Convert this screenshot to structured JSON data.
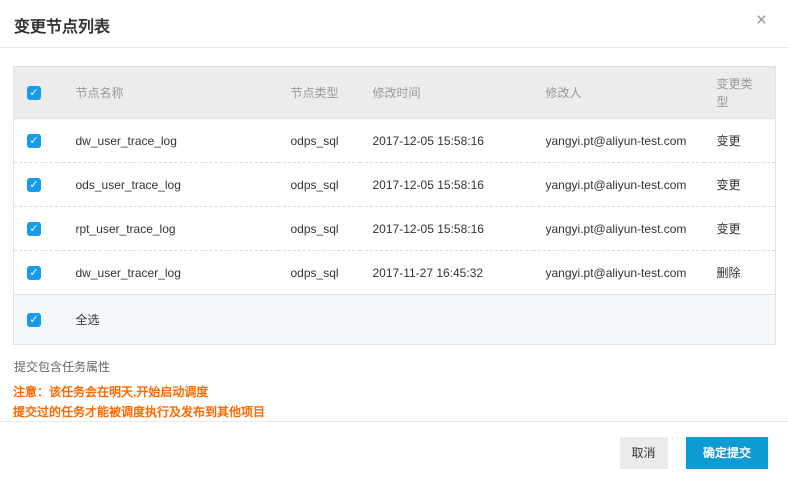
{
  "dialog": {
    "title": "变更节点列表"
  },
  "icons": {
    "check": "✓",
    "close": "×"
  },
  "table": {
    "headers": {
      "name": "节点名称",
      "type": "节点类型",
      "time": "修改时间",
      "person": "修改人",
      "change": "变更类型"
    },
    "rows": [
      {
        "name": "dw_user_trace_log",
        "type": "odps_sql",
        "time": "2017-12-05 15:58:16",
        "modifier": "yangyi.pt@aliyun-test.com",
        "change": "变更"
      },
      {
        "name": "ods_user_trace_log",
        "type": "odps_sql",
        "time": "2017-12-05 15:58:16",
        "modifier": "yangyi.pt@aliyun-test.com",
        "change": "变更"
      },
      {
        "name": "rpt_user_trace_log",
        "type": "odps_sql",
        "time": "2017-12-05 15:58:16",
        "modifier": "yangyi.pt@aliyun-test.com",
        "change": "变更"
      },
      {
        "name": "dw_user_tracer_log",
        "type": "odps_sql",
        "time": "2017-11-27 16:45:32",
        "modifier": "yangyi.pt@aliyun-test.com",
        "change": "删除"
      }
    ],
    "select_all_label": "全选"
  },
  "notes": {
    "attribute_label": "提交包含任务属性",
    "warning_line1": "注意：该任务会在明天,开始启动调度",
    "warning_line2": "提交过的任务才能被调度执行及发布到其他项目"
  },
  "footer": {
    "cancel_label": "取消",
    "confirm_label": "确定提交"
  },
  "colors": {
    "accent_blue": "#0e9bd4",
    "checkbox_blue": "#169bf0",
    "warning_orange": "#ff6a00"
  }
}
